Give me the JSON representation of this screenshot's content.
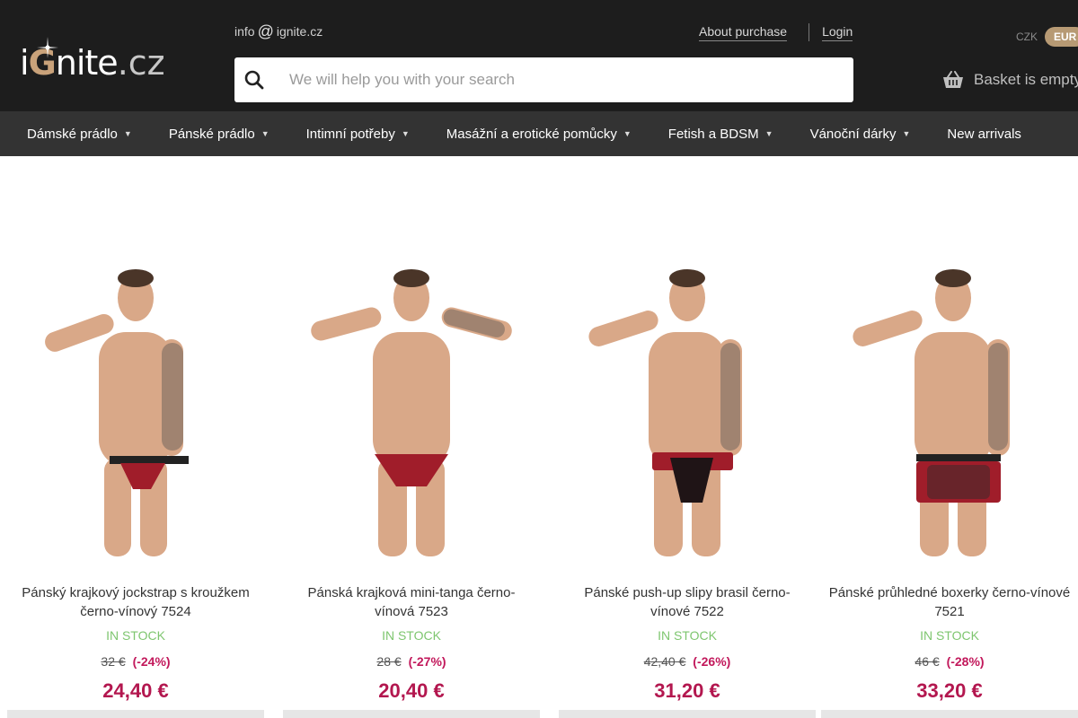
{
  "header": {
    "logo": {
      "pre": "i",
      "g": "G",
      "post": "nite",
      "tld": ".cz"
    },
    "email": {
      "user": "info",
      "at": "@",
      "domain": "ignite.cz"
    },
    "links": {
      "about": "About purchase",
      "login": "Login"
    },
    "search": {
      "placeholder": "We will help you with your search",
      "icon": "search-icon"
    },
    "currency": {
      "options": [
        "CZK",
        "EUR"
      ],
      "selected": "EUR"
    },
    "basket": {
      "label": "Basket is empty",
      "icon": "basket-icon"
    }
  },
  "nav": {
    "items": [
      {
        "label": "Dámské prádlo",
        "caret": "▼"
      },
      {
        "label": "Pánské prádlo",
        "caret": "▼"
      },
      {
        "label": "Intimní potřeby",
        "caret": "▼"
      },
      {
        "label": "Masážní a erotické pomůcky",
        "caret": "▼"
      },
      {
        "label": "Fetish a BDSM",
        "caret": "▼"
      },
      {
        "label": "Vánoční dárky",
        "caret": "▼"
      },
      {
        "label": "New arrivals",
        "caret": ""
      }
    ]
  },
  "products": [
    {
      "name": "Pánský krajkový jockstrap s kroužkem černo-vínový 7524",
      "stock": "IN STOCK",
      "old_price": "32 €",
      "discount": "(-24%)",
      "price": "24,40 €"
    },
    {
      "name": "Pánská krajková mini-tanga černo-vínová 7523",
      "stock": "IN STOCK",
      "old_price": "28 €",
      "discount": "(-27%)",
      "price": "20,40 €"
    },
    {
      "name": "Pánské push-up slipy brasil černo-vínové 7522",
      "stock": "IN STOCK",
      "old_price": "42,40 €",
      "discount": "(-26%)",
      "price": "31,20 €"
    },
    {
      "name": "Pánské průhledné boxerky černo-vínové 7521",
      "stock": "IN STOCK",
      "old_price": "46 €",
      "discount": "(-28%)",
      "price": "33,20 €"
    }
  ],
  "colors": {
    "header_bg": "#1d1d1d",
    "nav_bg": "#333333",
    "accent_gold": "#b79a74",
    "price": "#b3174f",
    "in_stock": "#7ec66f"
  }
}
